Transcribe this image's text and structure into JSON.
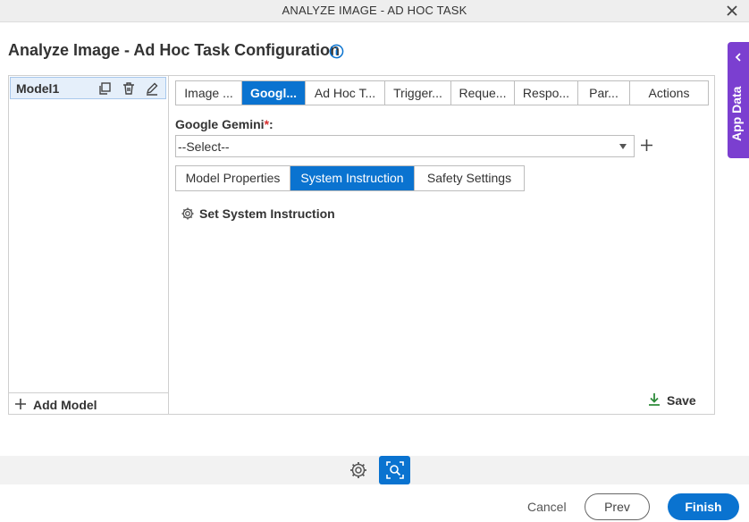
{
  "window": {
    "title": "ANALYZE IMAGE - AD HOC TASK"
  },
  "page": {
    "heading": "Analyze Image - Ad Hoc Task Configuration"
  },
  "models": {
    "items": [
      {
        "label": "Model1"
      }
    ],
    "add_label": "Add Model"
  },
  "tabs": [
    {
      "label": "Image ..."
    },
    {
      "label": "Googl..."
    },
    {
      "label": "Ad Hoc T..."
    },
    {
      "label": "Trigger..."
    },
    {
      "label": "Reque..."
    },
    {
      "label": "Respo..."
    },
    {
      "label": "Par..."
    },
    {
      "label": "Actions"
    }
  ],
  "active_tab": "Googl...",
  "gemini": {
    "label": "Google Gemini",
    "required_mark": "*",
    "colon": ":",
    "selected": "--Select--"
  },
  "subtabs": [
    {
      "label": "Model Properties"
    },
    {
      "label": "System Instruction"
    },
    {
      "label": "Safety Settings"
    }
  ],
  "active_subtab": "System Instruction",
  "system_instruction": {
    "link_label": "Set System Instruction"
  },
  "save_label": "Save",
  "app_data_label": "App Data",
  "footer": {
    "cancel": "Cancel",
    "prev": "Prev",
    "finish": "Finish"
  },
  "colors": {
    "accent": "#0a73d0",
    "app_data": "#7b3fd0",
    "required": "#d62e2e",
    "save_icon": "#2e8b3a"
  },
  "icons": {
    "close": "close-icon",
    "info": "info-icon",
    "copy": "copy-icon",
    "delete": "trash-icon",
    "edit": "pencil-icon",
    "add": "plus-icon",
    "gear": "gear-icon",
    "save": "download-icon",
    "chevron": "chevron-left-icon",
    "image_analyze": "image-search-icon"
  }
}
